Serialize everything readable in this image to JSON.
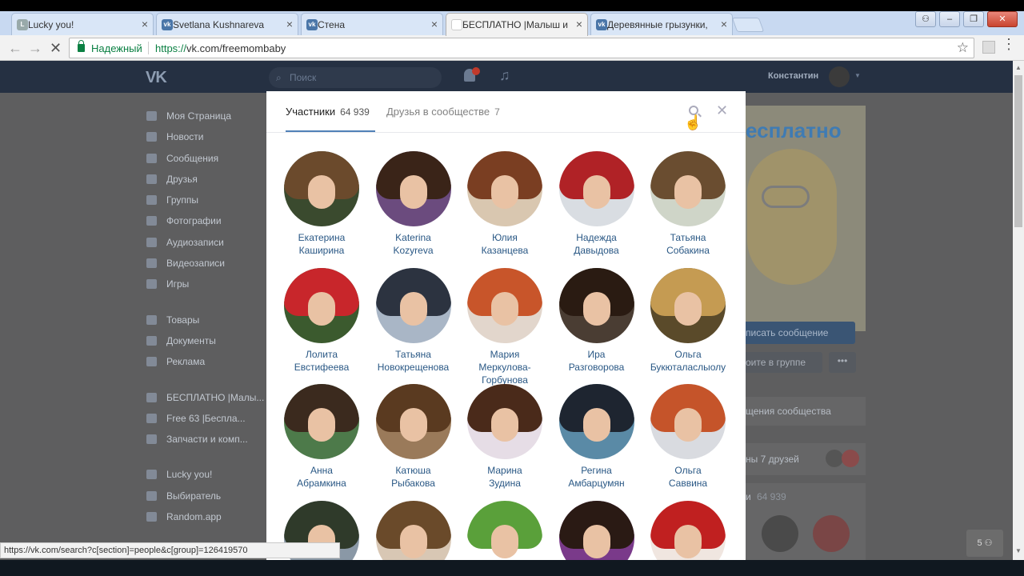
{
  "browser": {
    "tabs": [
      {
        "title": "Lucky you!",
        "active": false,
        "favicon": "lucky-favicon"
      },
      {
        "title": "Svetlana Kushnareva",
        "active": false,
        "favicon": "vk-favicon"
      },
      {
        "title": "Стена",
        "active": false,
        "favicon": "vk-favicon"
      },
      {
        "title": "БЕСПЛАТНО |Малыш и",
        "active": true,
        "favicon": "loading-favicon"
      },
      {
        "title": "Деревянные грызунки,",
        "active": false,
        "favicon": "vk-favicon"
      }
    ],
    "secure_label": "Надежный",
    "url_scheme": "https://",
    "url_host": "vk.com/freemombaby",
    "status_url": "https://vk.com/search?c[section]=people&c[group]=126419570"
  },
  "vk": {
    "search_placeholder": "Поиск",
    "user_name": "Константин",
    "menu_main": [
      "Моя Страница",
      "Новости",
      "Сообщения",
      "Друзья",
      "Группы",
      "Фотографии",
      "Аудиозаписи",
      "Видеозаписи",
      "Игры"
    ],
    "menu_secondary": [
      "Товары",
      "Документы",
      "Реклама"
    ],
    "menu_groups": [
      "БЕСПЛАТНО |Малы...",
      "Free 63 |Беспла...",
      "Запчасти и комп..."
    ],
    "menu_apps": [
      "Lucky you!",
      "Выбиратель",
      "Random.app"
    ],
    "cover_text": "есплатно",
    "message_button": "писать сообщение",
    "in_group_button": "оите в группе",
    "dots_button": "•••",
    "notify_text": "щения сообщества",
    "friends_text": "ны 7 друзей",
    "members_text": "и",
    "members_count": "64 939",
    "help_count": "5"
  },
  "modal": {
    "tab_members": {
      "label": "Участники",
      "count": "64 939"
    },
    "tab_friends": {
      "label": "Друзья в сообществе",
      "count": "7"
    },
    "members": [
      {
        "first": "Екатерина",
        "last": "Каширина",
        "hair": "#6b4a2c",
        "bg": "#3a4a2e"
      },
      {
        "first": "Katerina",
        "last": "Kozyreva",
        "hair": "#3a2418",
        "bg": "#6b4b7e"
      },
      {
        "first": "Юлия",
        "last": "Казанцева",
        "hair": "#7a3e22",
        "bg": "#d9c7b0"
      },
      {
        "first": "Надежда",
        "last": "Давыдова",
        "hair": "#b02226",
        "bg": "#d9dde2"
      },
      {
        "first": "Татьяна",
        "last": "Собакина",
        "hair": "#6a4d30",
        "bg": "#cfd5c8"
      },
      {
        "first": "Лолита",
        "last": "Евстифеева",
        "hair": "#c8262b",
        "bg": "#3b5a2e"
      },
      {
        "first": "Татьяна",
        "last": "Новокрещенова",
        "hair": "#2c3340",
        "bg": "#a9b6c6"
      },
      {
        "first": "Мария",
        "last": "Меркулова-Горбунова",
        "hair": "#c8552a",
        "bg": "#e2d6cc"
      },
      {
        "first": "Ира",
        "last": "Разговорова",
        "hair": "#2a1b12",
        "bg": "#4a3d33"
      },
      {
        "first": "Ольга",
        "last": "Букюталаслыолу",
        "hair": "#c59b52",
        "bg": "#5a4a2a"
      },
      {
        "first": "Анна",
        "last": "Абрамкина",
        "hair": "#3b2a1e",
        "bg": "#4d7a4a"
      },
      {
        "first": "Катюша",
        "last": "Рыбакова",
        "hair": "#5a3a20",
        "bg": "#9a7a5a"
      },
      {
        "first": "Марина",
        "last": "Зудина",
        "hair": "#4a2a1a",
        "bg": "#e6dde6"
      },
      {
        "first": "Регина",
        "last": "Амбарцумян",
        "hair": "#1e2530",
        "bg": "#5a8aa6"
      },
      {
        "first": "Ольга",
        "last": "Саввина",
        "hair": "#c5542a",
        "bg": "#d9dbe0"
      },
      {
        "first": "",
        "last": "",
        "hair": "#2f3a2a",
        "bg": "#8a98a6"
      },
      {
        "first": "",
        "last": "",
        "hair": "#6a4a2a",
        "bg": "#d8c7b4"
      },
      {
        "first": "",
        "last": "",
        "hair": "#5aa03a",
        "bg": "#ffffff"
      },
      {
        "first": "",
        "last": "",
        "hair": "#2a1a14",
        "bg": "#7a3a8a"
      },
      {
        "first": "",
        "last": "",
        "hair": "#c02020",
        "bg": "#f0e6e0"
      }
    ]
  }
}
